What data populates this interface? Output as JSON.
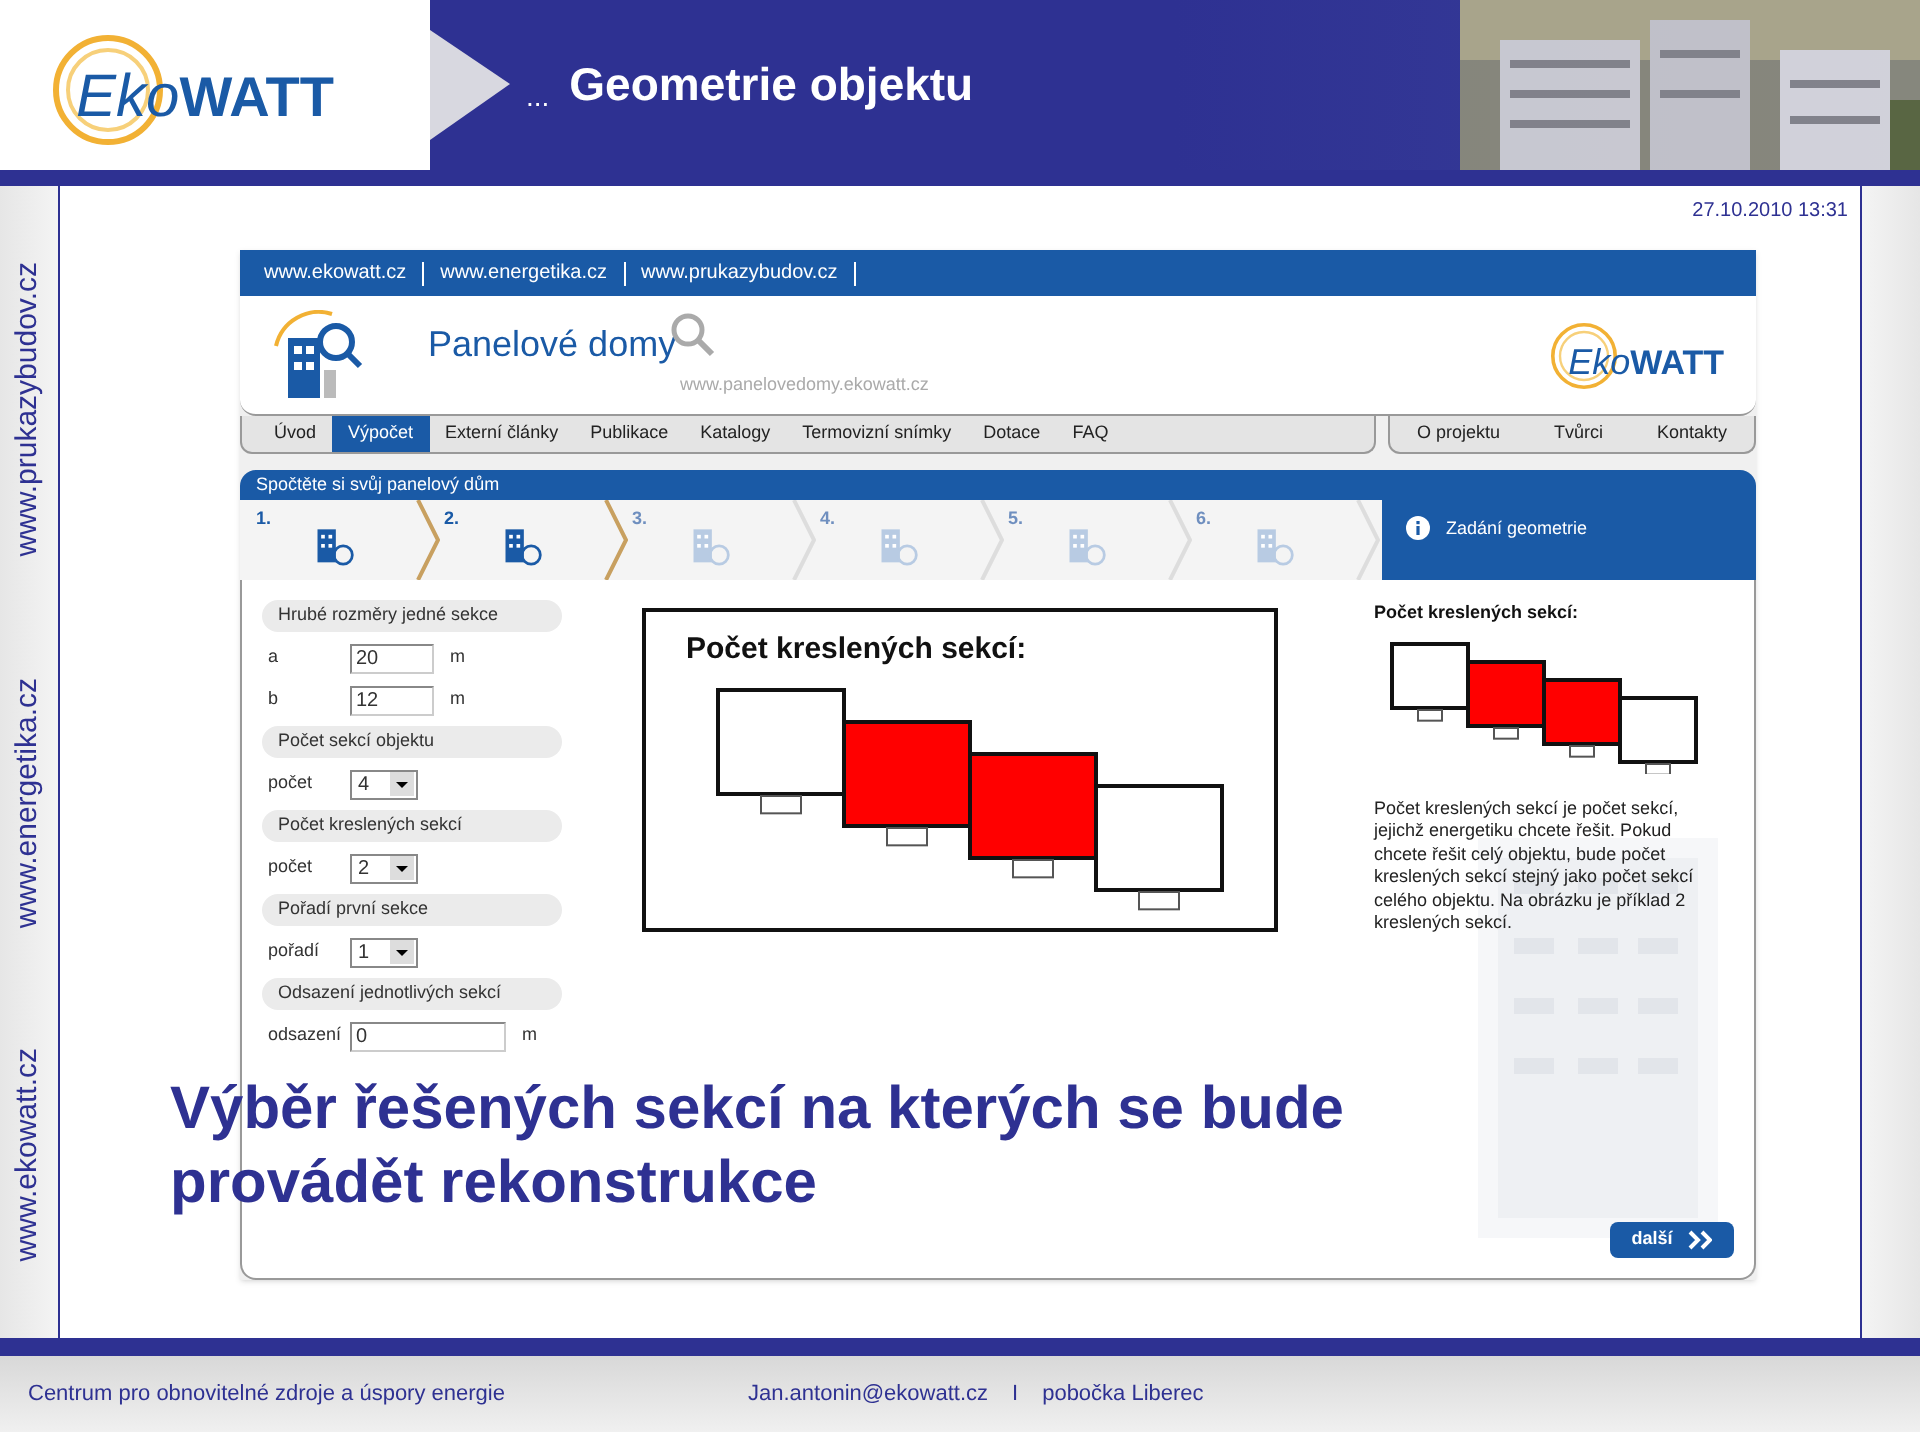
{
  "slide": {
    "logo": {
      "part1": "Eko",
      "part2": "WATT"
    },
    "title_prefix": "...",
    "title": "Geometrie objektu",
    "date": "27.10.2010 13:31",
    "side_links": [
      "www.prukazybudov.cz",
      "www.energetika.cz",
      "www.ekowatt.cz"
    ],
    "caption": "Výběr řešených sekcí na kterých se bude provádět rekonstrukce",
    "footer": {
      "left": "Centrum pro obnovitelné zdroje a úspory energie",
      "email": "Jan.antonin@ekowatt.cz",
      "separator": "I",
      "branch": "pobočka Liberec"
    }
  },
  "web": {
    "top_links": [
      "www.ekowatt.cz",
      "www.energetika.cz",
      "www.prukazybudov.cz"
    ],
    "site_title": "Panelové domy",
    "site_url": "www.panelovedomy.ekowatt.cz",
    "logo": {
      "part1": "Eko",
      "part2": "WATT"
    },
    "nav": [
      {
        "label": "Úvod",
        "selected": false
      },
      {
        "label": "Výpočet",
        "selected": true
      },
      {
        "label": "Externí články",
        "selected": false
      },
      {
        "label": "Publikace",
        "selected": false
      },
      {
        "label": "Katalogy",
        "selected": false
      },
      {
        "label": "Termovizní snímky",
        "selected": false
      },
      {
        "label": "Dotace",
        "selected": false
      },
      {
        "label": "FAQ",
        "selected": false
      }
    ],
    "nav_right": [
      "O projektu",
      "Tvůrci",
      "Kontakty"
    ],
    "section_title": "Spočtěte si svůj panelový dům",
    "steps": [
      {
        "number": "1.",
        "enabled": true
      },
      {
        "number": "2.",
        "enabled": true
      },
      {
        "number": "3.",
        "enabled": false
      },
      {
        "number": "4.",
        "enabled": false
      },
      {
        "number": "5.",
        "enabled": false
      },
      {
        "number": "6.",
        "enabled": false
      }
    ],
    "info_label": "Zadání geometrie",
    "form": [
      {
        "kind": "header",
        "label": "Hrubé rozměry jedné sekce"
      },
      {
        "kind": "input",
        "label": "a",
        "value": "20",
        "unit": "m"
      },
      {
        "kind": "input",
        "label": "b",
        "value": "12",
        "unit": "m"
      },
      {
        "kind": "header",
        "label": "Počet sekcí objektu"
      },
      {
        "kind": "select",
        "label": "počet",
        "value": "4"
      },
      {
        "kind": "header",
        "label": "Počet kreslených sekcí"
      },
      {
        "kind": "select",
        "label": "počet",
        "value": "2"
      },
      {
        "kind": "header",
        "label": "Pořadí první sekce"
      },
      {
        "kind": "select",
        "label": "pořadí",
        "value": "1"
      },
      {
        "kind": "header",
        "label": "Odsazení jednotlivých sekcí"
      },
      {
        "kind": "long_input",
        "label": "odsazení",
        "value": "0",
        "unit": "m"
      }
    ],
    "diagram": {
      "title": "Počet kreslených sekcí:",
      "sections": [
        {
          "selected": false
        },
        {
          "selected": true
        },
        {
          "selected": true
        },
        {
          "selected": false
        }
      ]
    },
    "preview": {
      "title": "Počet kreslených sekcí:",
      "sections": [
        {
          "selected": false
        },
        {
          "selected": true
        },
        {
          "selected": true
        },
        {
          "selected": false
        }
      ]
    },
    "help_text": "Počet kreslených sekcí je počet sekcí, jejichž energetiku chcete řešit. Pokud chcete řešit celý objektu, bude počet kreslených sekcí stejný jako počet sekcí celého objektu. Na obrázku je příklad 2 kreslených sekcí.",
    "next_button": "další"
  }
}
